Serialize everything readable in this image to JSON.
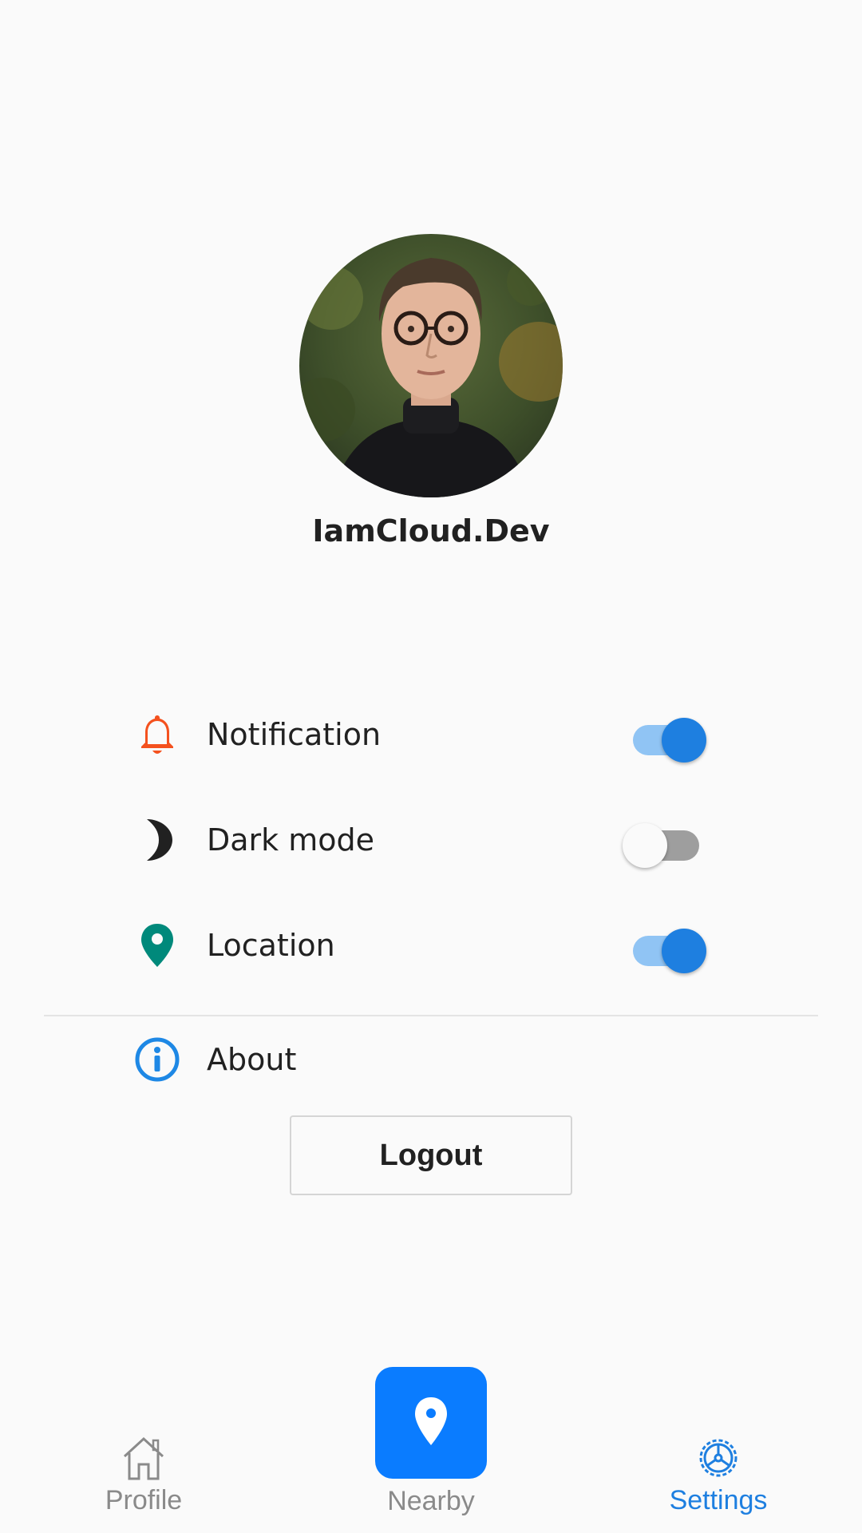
{
  "profile": {
    "username": "IamCloud.Dev"
  },
  "settings": {
    "items": [
      {
        "label": "Notification",
        "icon": "bell-icon",
        "icon_color": "#f4511e",
        "toggle": true
      },
      {
        "label": "Dark mode",
        "icon": "moon-icon",
        "icon_color": "#212121",
        "toggle": false
      },
      {
        "label": "Location",
        "icon": "map-pin-icon",
        "icon_color": "#00897b",
        "toggle": true
      }
    ],
    "about_label": "About",
    "about_icon_color": "#1e88e5",
    "logout_label": "Logout"
  },
  "bottom_nav": {
    "items": [
      {
        "label": "Profile",
        "icon": "home-icon",
        "active": false
      },
      {
        "label": "Nearby",
        "icon": "map-pin-icon",
        "active": false
      },
      {
        "label": "Settings",
        "icon": "gear-icon",
        "active": true
      }
    ],
    "active_color": "#1e7fe0",
    "inactive_color": "#8a8a8a",
    "fab_color": "#0a7cff"
  },
  "toggle_colors": {
    "on_track": "#90c4f4",
    "on_thumb": "#1e7fe0",
    "off_track": "#9e9e9e",
    "off_thumb": "#fafafa"
  }
}
